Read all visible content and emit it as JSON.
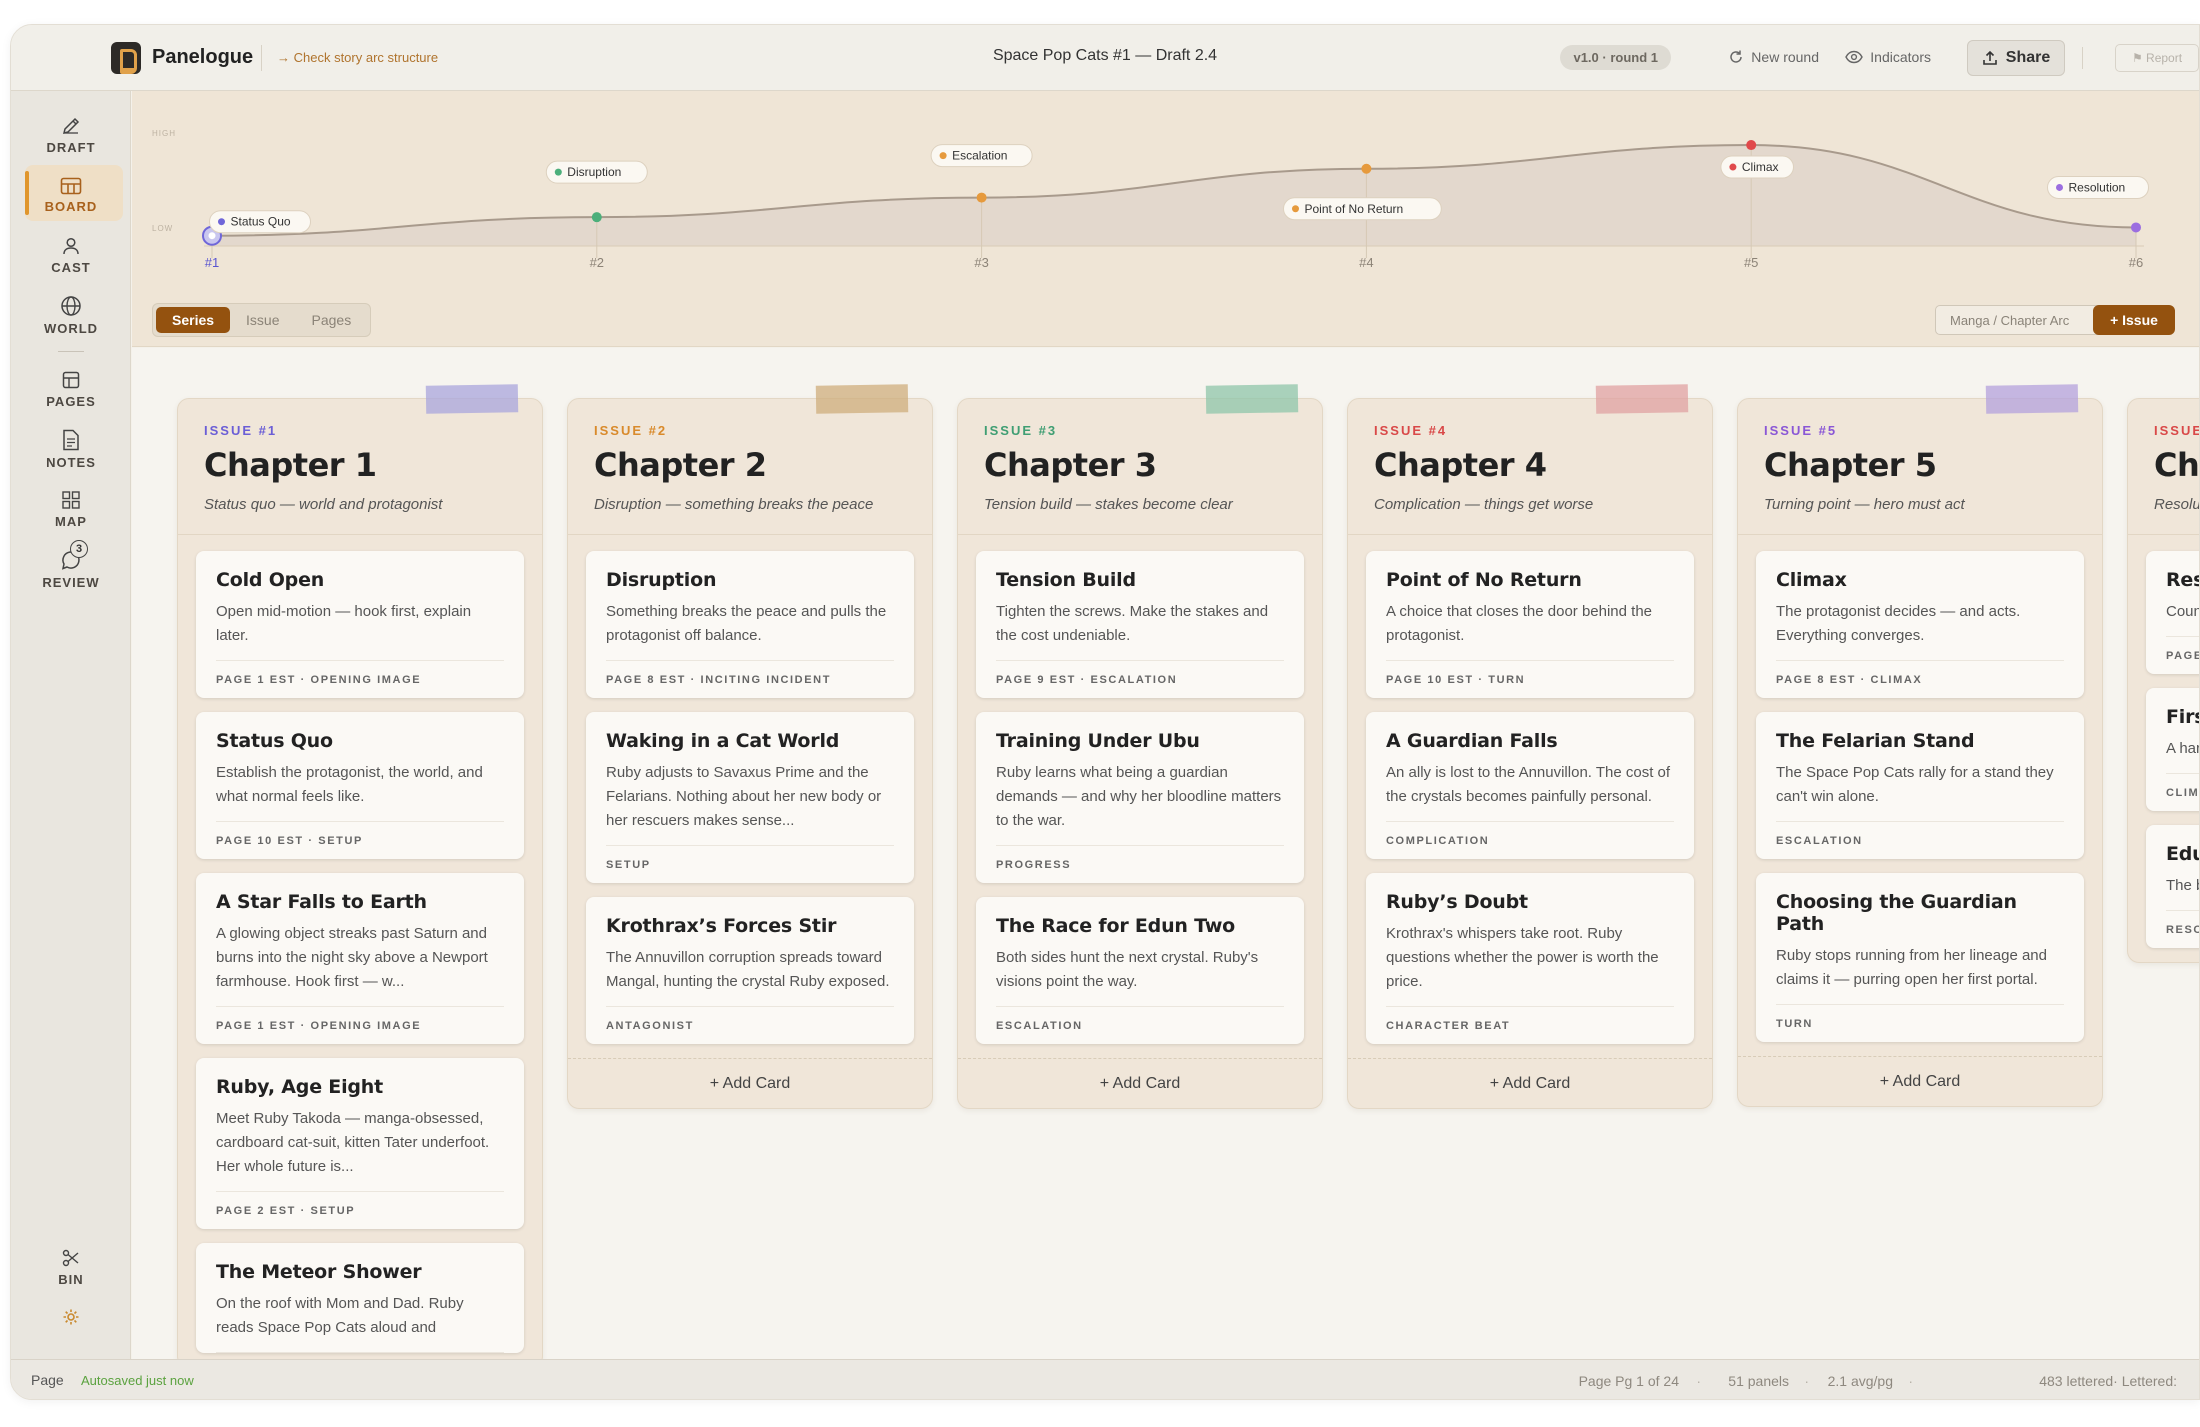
{
  "app": {
    "name": "Panelogue",
    "hint": "→ Check story arc structure",
    "doc_title": "Space Pop Cats #1 — Draft 2.4"
  },
  "toolbar": {
    "version": "v1.0 · round 1",
    "new_round": "New round",
    "indicators": "Indicators",
    "share": "Share",
    "report": "⚑ Report"
  },
  "sidebar": {
    "items": [
      {
        "label": "DRAFT",
        "icon": "pen-icon"
      },
      {
        "label": "BOARD",
        "icon": "board-icon",
        "active": true
      },
      {
        "label": "CAST",
        "icon": "person-icon"
      },
      {
        "label": "WORLD",
        "icon": "globe-icon"
      },
      {
        "label": "PAGES",
        "icon": "pages-icon"
      },
      {
        "label": "NOTES",
        "icon": "notes-icon"
      },
      {
        "label": "MAP",
        "icon": "grid-icon"
      },
      {
        "label": "REVIEW",
        "icon": "comment-icon",
        "badge": "3"
      },
      {
        "label": "BIN",
        "icon": "scissors-icon"
      }
    ]
  },
  "arc": {
    "high_label": "HIGH",
    "low_label": "LOW",
    "beats": [
      {
        "tick": "#1",
        "label": "Status Quo",
        "level": 0.1,
        "color": "#6f66d9"
      },
      {
        "tick": "#2",
        "label": "Disruption",
        "level": 0.28,
        "color": "#4caf7b"
      },
      {
        "tick": "#3",
        "label": "Escalation",
        "level": 0.47,
        "color": "#e69a3d"
      },
      {
        "tick": "#4",
        "label": "Point of No Return",
        "level": 0.75,
        "color": "#e69a3d"
      },
      {
        "tick": "#5",
        "label": "Climax",
        "level": 0.98,
        "color": "#e0494b"
      },
      {
        "tick": "#6",
        "label": "Resolution",
        "level": 0.18,
        "color": "#9b6ee0"
      }
    ],
    "view_tabs": [
      "Series",
      "Issue",
      "Pages"
    ],
    "active_tab": "Series",
    "template_select": "Manga / Chapter Arc",
    "add_issue": "+ Issue"
  },
  "columns": [
    {
      "issue": "ISSUE #1",
      "title": "Chapter 1",
      "subtitle": "Status quo — world and protagonist",
      "color": "#6b5ed6",
      "tape": "#aaa6dc",
      "cards": [
        {
          "title": "Cold Open",
          "body": "Open mid-motion — hook first, explain later.",
          "meta": "PAGE 1 EST · OPENING IMAGE"
        },
        {
          "title": "Status Quo",
          "body": "Establish the protagonist, the world, and what normal feels like.",
          "meta": "PAGE 10 EST · SETUP"
        },
        {
          "title": "A Star Falls to Earth",
          "body": "A glowing object streaks past Saturn and burns into the night sky above a Newport farmhouse. Hook first — w...",
          "meta": "PAGE 1 EST · OPENING IMAGE"
        },
        {
          "title": "Ruby, Age Eight",
          "body": "Meet Ruby Takoda — manga-obsessed, cardboard cat-suit, kitten Tater underfoot. Her whole future is...",
          "meta": "PAGE 2 EST · SETUP"
        },
        {
          "title": "The Meteor Shower",
          "body": "On the roof with Mom and Dad. Ruby reads Space Pop Cats aloud and",
          "meta": ""
        }
      ],
      "add": ""
    },
    {
      "issue": "ISSUE #2",
      "title": "Chapter 2",
      "subtitle": "Disruption — something breaks the peace",
      "color": "#d98a2b",
      "tape": "#cfae7c",
      "cards": [
        {
          "title": "Disruption",
          "body": "Something breaks the peace and pulls the protagonist off balance.",
          "meta": "PAGE 8 EST · INCITING INCIDENT"
        },
        {
          "title": "Waking in a Cat World",
          "body": "Ruby adjusts to Savaxus Prime and the Felarians. Nothing about her new body or her rescuers makes sense...",
          "meta": "SETUP"
        },
        {
          "title": "Krothrax’s Forces Stir",
          "body": "The Annuvillon corruption spreads toward Mangal, hunting the crystal Ruby exposed.",
          "meta": "ANTAGONIST"
        }
      ],
      "add": "+ Add Card"
    },
    {
      "issue": "ISSUE #3",
      "title": "Chapter 3",
      "subtitle": "Tension build — stakes become clear",
      "color": "#3f9e73",
      "tape": "#8fc5a9",
      "cards": [
        {
          "title": "Tension Build",
          "body": "Tighten the screws. Make the stakes and the cost undeniable.",
          "meta": "PAGE 9 EST · ESCALATION"
        },
        {
          "title": "Training Under Ubu",
          "body": "Ruby learns what being a guardian demands — and why her bloodline matters to the war.",
          "meta": "PROGRESS"
        },
        {
          "title": "The Race for Edun Two",
          "body": "Both sides hunt the next crystal. Ruby's visions point the way.",
          "meta": "ESCALATION"
        }
      ],
      "add": "+ Add Card"
    },
    {
      "issue": "ISSUE #4",
      "title": "Chapter 4",
      "subtitle": "Complication — things get worse",
      "color": "#d94848",
      "tape": "#e0a2a2",
      "cards": [
        {
          "title": "Point of No Return",
          "body": "A choice that closes the door behind the protagonist.",
          "meta": "PAGE 10 EST · TURN"
        },
        {
          "title": "A Guardian Falls",
          "body": "An ally is lost to the Annuvillon. The cost of the crystals becomes painfully personal.",
          "meta": "COMPLICATION"
        },
        {
          "title": "Ruby’s Doubt",
          "body": "Krothrax's whispers take root. Ruby questions whether the power is worth the price.",
          "meta": "CHARACTER BEAT"
        }
      ],
      "add": "+ Add Card"
    },
    {
      "issue": "ISSUE #5",
      "title": "Chapter 5",
      "subtitle": "Turning point — hero must act",
      "color": "#8a57d6",
      "tape": "#b4a2dc",
      "cards": [
        {
          "title": "Climax",
          "body": "The protagonist decides — and acts. Everything converges.",
          "meta": "PAGE 8 EST · CLIMAX"
        },
        {
          "title": "The Felarian Stand",
          "body": "The Space Pop Cats rally for a stand they can't win alone.",
          "meta": "ESCALATION"
        },
        {
          "title": "Choosing the Guardian Path",
          "body": "Ruby stops running from her lineage and claims it — purring open her first portal.",
          "meta": "TURN"
        }
      ],
      "add": "+ Add Card"
    },
    {
      "issue": "ISSUE #",
      "title": "Cha",
      "subtitle": "Resolut",
      "color": "#d94848",
      "tape": "",
      "cards": [
        {
          "title": "Reso",
          "body": "Coun chang",
          "meta": "PAGE"
        },
        {
          "title": "First",
          "body": "A har safe – strong",
          "meta": "CLIMA"
        },
        {
          "title": "Edun",
          "body": "The b real jo",
          "meta": "RESOL"
        }
      ],
      "add": ""
    }
  ],
  "statusbar": {
    "mode": "Page",
    "saved": "Autosaved just now",
    "page": "Page Pg 1 of 24",
    "panels": "51 panels",
    "avg": "2.1 avg/pg",
    "lettered": "483 lettered· Lettered:"
  }
}
